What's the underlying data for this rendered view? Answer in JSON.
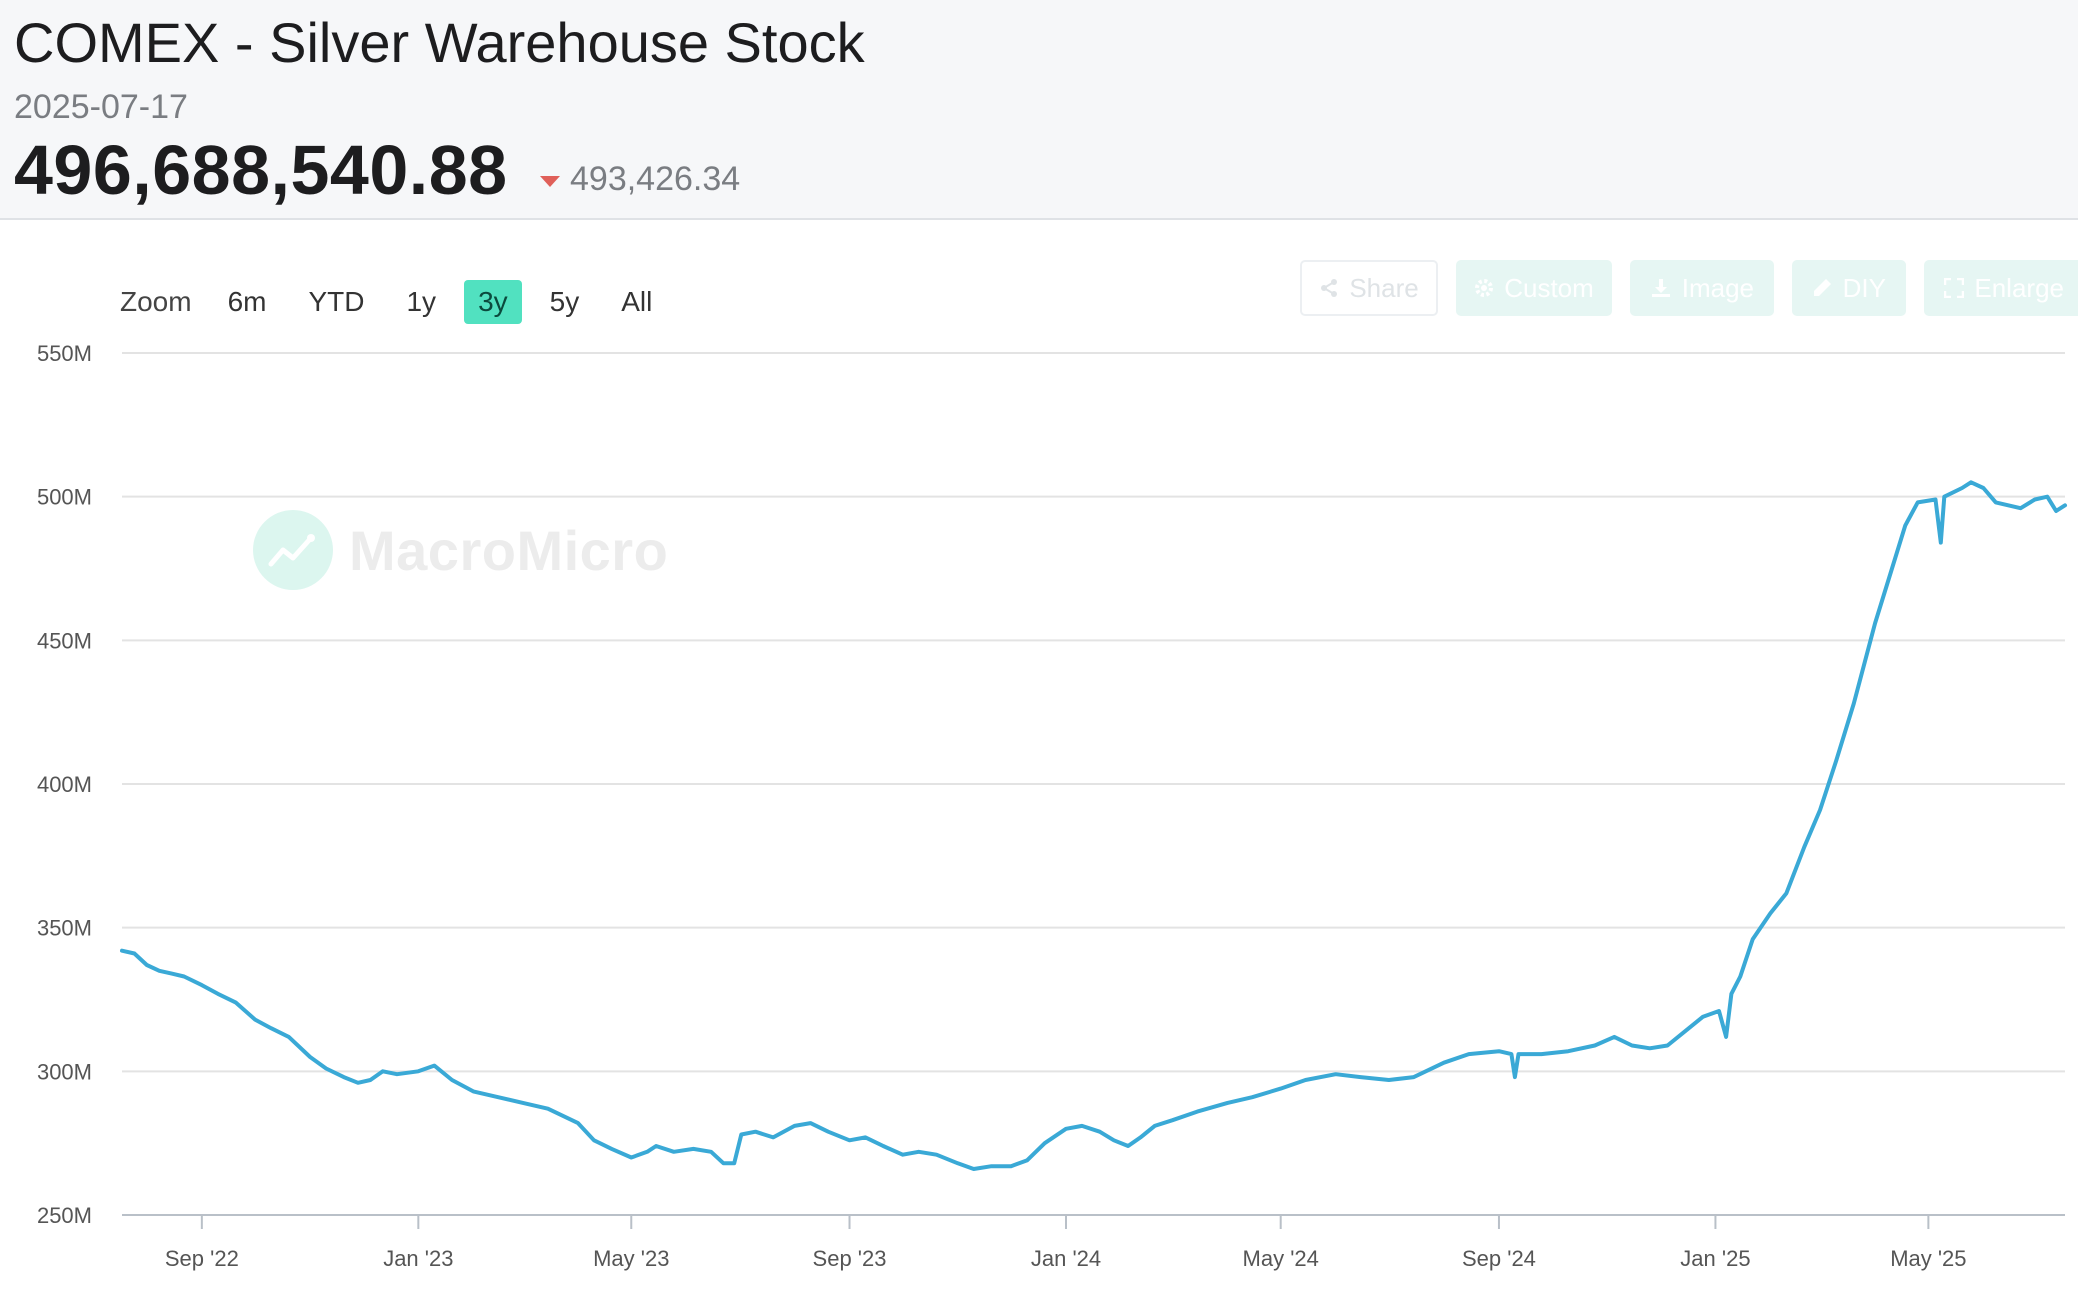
{
  "header": {
    "title": "COMEX - Silver Warehouse Stock",
    "date": "2025-07-17",
    "value": "496,688,540.88",
    "change": "493,426.34",
    "change_direction": "down"
  },
  "range_selector": {
    "zoom_label": "Zoom",
    "options": [
      "6m",
      "YTD",
      "1y",
      "3y",
      "5y",
      "All"
    ],
    "selected": "3y"
  },
  "toolbar": {
    "share_label": "Share",
    "custom_label": "Custom",
    "image_label": "Image",
    "diy_label": "DIY",
    "enlarge_label": "Enlarge"
  },
  "watermark": "MacroMicro",
  "colors": {
    "line": "#3aa9d6",
    "accent": "#51e1c0",
    "down": "#e0605a",
    "grid": "#e3e3e3"
  },
  "chart_data": {
    "type": "line",
    "title": "",
    "xlabel": "",
    "ylabel": "",
    "ylim": [
      250000000,
      550000000
    ],
    "xlim": [
      "2022-07-18",
      "2025-07-17"
    ],
    "y_ticks": [
      {
        "value": 250000000,
        "label": "250M"
      },
      {
        "value": 300000000,
        "label": "300M"
      },
      {
        "value": 350000000,
        "label": "350M"
      },
      {
        "value": 400000000,
        "label": "400M"
      },
      {
        "value": 450000000,
        "label": "450M"
      },
      {
        "value": 500000000,
        "label": "500M"
      },
      {
        "value": 550000000,
        "label": "550M"
      }
    ],
    "x_ticks": [
      {
        "date": "2022-09-01",
        "label": "Sep '22"
      },
      {
        "date": "2023-01-01",
        "label": "Jan '23"
      },
      {
        "date": "2023-05-01",
        "label": "May '23"
      },
      {
        "date": "2023-09-01",
        "label": "Sep '23"
      },
      {
        "date": "2024-01-01",
        "label": "Jan '24"
      },
      {
        "date": "2024-05-01",
        "label": "May '24"
      },
      {
        "date": "2024-09-01",
        "label": "Sep '24"
      },
      {
        "date": "2025-01-01",
        "label": "Jan '25"
      },
      {
        "date": "2025-05-01",
        "label": "May '25"
      }
    ],
    "grid": true,
    "legend": "none",
    "series": [
      {
        "points": [
          [
            "2022-07-18",
            342000000
          ],
          [
            "2022-07-25",
            341000000
          ],
          [
            "2022-08-01",
            337000000
          ],
          [
            "2022-08-08",
            335000000
          ],
          [
            "2022-08-15",
            334000000
          ],
          [
            "2022-08-22",
            333000000
          ],
          [
            "2022-09-01",
            330000000
          ],
          [
            "2022-09-10",
            327000000
          ],
          [
            "2022-09-20",
            324000000
          ],
          [
            "2022-10-01",
            318000000
          ],
          [
            "2022-10-10",
            315000000
          ],
          [
            "2022-10-20",
            312000000
          ],
          [
            "2022-11-01",
            305000000
          ],
          [
            "2022-11-10",
            301000000
          ],
          [
            "2022-11-20",
            298000000
          ],
          [
            "2022-11-28",
            296000000
          ],
          [
            "2022-12-05",
            297000000
          ],
          [
            "2022-12-12",
            300000000
          ],
          [
            "2022-12-20",
            299000000
          ],
          [
            "2023-01-01",
            300000000
          ],
          [
            "2023-01-10",
            302000000
          ],
          [
            "2023-01-20",
            297000000
          ],
          [
            "2023-02-01",
            293000000
          ],
          [
            "2023-02-15",
            291000000
          ],
          [
            "2023-03-01",
            289000000
          ],
          [
            "2023-03-15",
            287000000
          ],
          [
            "2023-04-01",
            282000000
          ],
          [
            "2023-04-10",
            276000000
          ],
          [
            "2023-04-20",
            273000000
          ],
          [
            "2023-05-01",
            270000000
          ],
          [
            "2023-05-10",
            272000000
          ],
          [
            "2023-05-15",
            274000000
          ],
          [
            "2023-05-25",
            272000000
          ],
          [
            "2023-06-05",
            273000000
          ],
          [
            "2023-06-15",
            272000000
          ],
          [
            "2023-06-22",
            268000000
          ],
          [
            "2023-06-28",
            268000000
          ],
          [
            "2023-07-02",
            278000000
          ],
          [
            "2023-07-10",
            279000000
          ],
          [
            "2023-07-20",
            277000000
          ],
          [
            "2023-08-01",
            281000000
          ],
          [
            "2023-08-10",
            282000000
          ],
          [
            "2023-08-20",
            279000000
          ],
          [
            "2023-09-01",
            276000000
          ],
          [
            "2023-09-10",
            277000000
          ],
          [
            "2023-09-20",
            274000000
          ],
          [
            "2023-10-01",
            271000000
          ],
          [
            "2023-10-10",
            272000000
          ],
          [
            "2023-10-20",
            271000000
          ],
          [
            "2023-11-01",
            268000000
          ],
          [
            "2023-11-10",
            266000000
          ],
          [
            "2023-11-20",
            267000000
          ],
          [
            "2023-12-01",
            267000000
          ],
          [
            "2023-12-10",
            269000000
          ],
          [
            "2023-12-20",
            275000000
          ],
          [
            "2024-01-01",
            280000000
          ],
          [
            "2024-01-10",
            281000000
          ],
          [
            "2024-01-20",
            279000000
          ],
          [
            "2024-01-28",
            276000000
          ],
          [
            "2024-02-05",
            274000000
          ],
          [
            "2024-02-12",
            277000000
          ],
          [
            "2024-02-20",
            281000000
          ],
          [
            "2024-03-01",
            283000000
          ],
          [
            "2024-03-15",
            286000000
          ],
          [
            "2024-04-01",
            289000000
          ],
          [
            "2024-04-15",
            291000000
          ],
          [
            "2024-05-01",
            294000000
          ],
          [
            "2024-05-15",
            297000000
          ],
          [
            "2024-06-01",
            299000000
          ],
          [
            "2024-06-15",
            298000000
          ],
          [
            "2024-07-01",
            297000000
          ],
          [
            "2024-07-15",
            298000000
          ],
          [
            "2024-08-01",
            303000000
          ],
          [
            "2024-08-15",
            306000000
          ],
          [
            "2024-09-01",
            307000000
          ],
          [
            "2024-09-08",
            306000000
          ],
          [
            "2024-09-10",
            298000000
          ],
          [
            "2024-09-12",
            306000000
          ],
          [
            "2024-09-25",
            306000000
          ],
          [
            "2024-10-10",
            307000000
          ],
          [
            "2024-10-25",
            309000000
          ],
          [
            "2024-11-05",
            312000000
          ],
          [
            "2024-11-15",
            309000000
          ],
          [
            "2024-11-25",
            308000000
          ],
          [
            "2024-12-05",
            309000000
          ],
          [
            "2024-12-15",
            314000000
          ],
          [
            "2024-12-25",
            319000000
          ],
          [
            "2025-01-03",
            321000000
          ],
          [
            "2025-01-07",
            312000000
          ],
          [
            "2025-01-10",
            327000000
          ],
          [
            "2025-01-15",
            333000000
          ],
          [
            "2025-01-22",
            346000000
          ],
          [
            "2025-02-01",
            355000000
          ],
          [
            "2025-02-10",
            362000000
          ],
          [
            "2025-02-20",
            378000000
          ],
          [
            "2025-03-01",
            391000000
          ],
          [
            "2025-03-10",
            408000000
          ],
          [
            "2025-03-20",
            428000000
          ],
          [
            "2025-04-01",
            456000000
          ],
          [
            "2025-04-10",
            474000000
          ],
          [
            "2025-04-18",
            490000000
          ],
          [
            "2025-04-25",
            498000000
          ],
          [
            "2025-05-05",
            499000000
          ],
          [
            "2025-05-08",
            484000000
          ],
          [
            "2025-05-10",
            500000000
          ],
          [
            "2025-05-20",
            503000000
          ],
          [
            "2025-05-25",
            505000000
          ],
          [
            "2025-06-01",
            503000000
          ],
          [
            "2025-06-08",
            498000000
          ],
          [
            "2025-06-15",
            497000000
          ],
          [
            "2025-06-22",
            496000000
          ],
          [
            "2025-06-30",
            499000000
          ],
          [
            "2025-07-07",
            500000000
          ],
          [
            "2025-07-12",
            495000000
          ],
          [
            "2025-07-17",
            497000000
          ]
        ]
      }
    ]
  }
}
